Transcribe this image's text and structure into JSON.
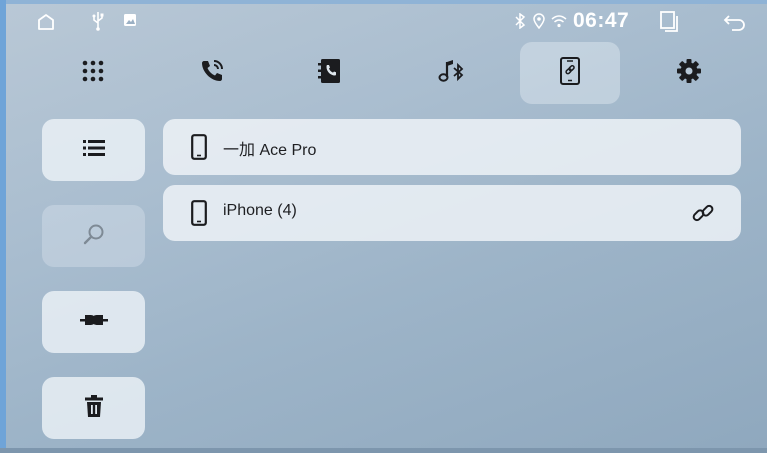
{
  "status_bar": {
    "time": "06:47",
    "icons": [
      "home-icon",
      "usb-icon",
      "image-icon",
      "bluetooth-icon",
      "location-icon",
      "wifi-icon",
      "window-icon",
      "back-icon"
    ]
  },
  "tabs": [
    {
      "name": "apps-grid-icon",
      "active": false
    },
    {
      "name": "phone-call-icon",
      "active": false
    },
    {
      "name": "contacts-icon",
      "active": false
    },
    {
      "name": "bluetooth-music-icon",
      "active": false
    },
    {
      "name": "connected-devices-icon",
      "active": true
    },
    {
      "name": "settings-gear-icon",
      "active": false
    }
  ],
  "sidebar": {
    "buttons": [
      {
        "name": "list-button",
        "icon": "list-icon",
        "enabled": true
      },
      {
        "name": "search-button",
        "icon": "search-icon",
        "enabled": false
      },
      {
        "name": "connect-button",
        "icon": "plug-icon",
        "enabled": true
      },
      {
        "name": "delete-button",
        "icon": "trash-icon",
        "enabled": true
      }
    ]
  },
  "devices": [
    {
      "name": "一加 Ace Pro",
      "connected": false
    },
    {
      "name": "iPhone (4)",
      "connected": true
    }
  ],
  "colors": {
    "accent_frame": "#6fa4d8",
    "icon_dark": "#1b1c1f",
    "status_white": "#ffffff"
  }
}
